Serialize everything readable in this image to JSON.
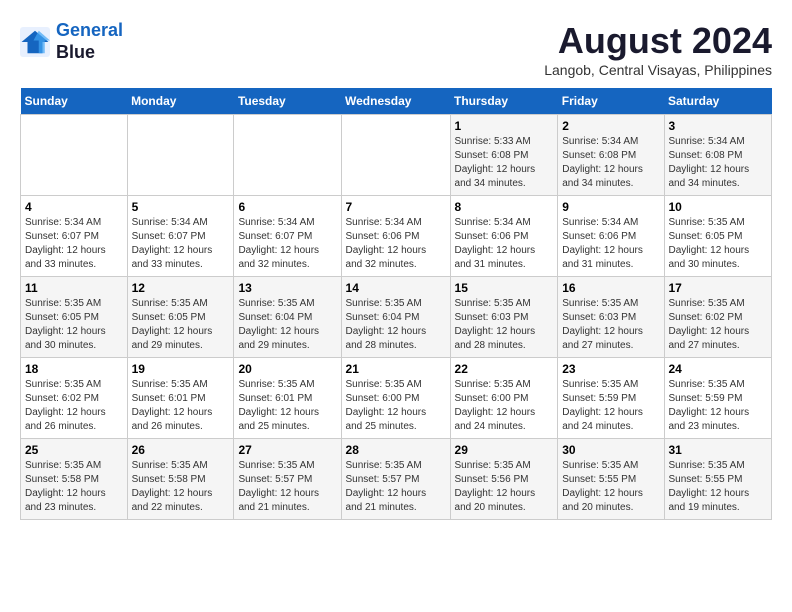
{
  "logo": {
    "line1": "General",
    "line2": "Blue"
  },
  "title": "August 2024",
  "subtitle": "Langob, Central Visayas, Philippines",
  "days_of_week": [
    "Sunday",
    "Monday",
    "Tuesday",
    "Wednesday",
    "Thursday",
    "Friday",
    "Saturday"
  ],
  "weeks": [
    [
      {
        "day": "",
        "info": ""
      },
      {
        "day": "",
        "info": ""
      },
      {
        "day": "",
        "info": ""
      },
      {
        "day": "",
        "info": ""
      },
      {
        "day": "1",
        "info": "Sunrise: 5:33 AM\nSunset: 6:08 PM\nDaylight: 12 hours\nand 34 minutes."
      },
      {
        "day": "2",
        "info": "Sunrise: 5:34 AM\nSunset: 6:08 PM\nDaylight: 12 hours\nand 34 minutes."
      },
      {
        "day": "3",
        "info": "Sunrise: 5:34 AM\nSunset: 6:08 PM\nDaylight: 12 hours\nand 34 minutes."
      }
    ],
    [
      {
        "day": "4",
        "info": "Sunrise: 5:34 AM\nSunset: 6:07 PM\nDaylight: 12 hours\nand 33 minutes."
      },
      {
        "day": "5",
        "info": "Sunrise: 5:34 AM\nSunset: 6:07 PM\nDaylight: 12 hours\nand 33 minutes."
      },
      {
        "day": "6",
        "info": "Sunrise: 5:34 AM\nSunset: 6:07 PM\nDaylight: 12 hours\nand 32 minutes."
      },
      {
        "day": "7",
        "info": "Sunrise: 5:34 AM\nSunset: 6:06 PM\nDaylight: 12 hours\nand 32 minutes."
      },
      {
        "day": "8",
        "info": "Sunrise: 5:34 AM\nSunset: 6:06 PM\nDaylight: 12 hours\nand 31 minutes."
      },
      {
        "day": "9",
        "info": "Sunrise: 5:34 AM\nSunset: 6:06 PM\nDaylight: 12 hours\nand 31 minutes."
      },
      {
        "day": "10",
        "info": "Sunrise: 5:35 AM\nSunset: 6:05 PM\nDaylight: 12 hours\nand 30 minutes."
      }
    ],
    [
      {
        "day": "11",
        "info": "Sunrise: 5:35 AM\nSunset: 6:05 PM\nDaylight: 12 hours\nand 30 minutes."
      },
      {
        "day": "12",
        "info": "Sunrise: 5:35 AM\nSunset: 6:05 PM\nDaylight: 12 hours\nand 29 minutes."
      },
      {
        "day": "13",
        "info": "Sunrise: 5:35 AM\nSunset: 6:04 PM\nDaylight: 12 hours\nand 29 minutes."
      },
      {
        "day": "14",
        "info": "Sunrise: 5:35 AM\nSunset: 6:04 PM\nDaylight: 12 hours\nand 28 minutes."
      },
      {
        "day": "15",
        "info": "Sunrise: 5:35 AM\nSunset: 6:03 PM\nDaylight: 12 hours\nand 28 minutes."
      },
      {
        "day": "16",
        "info": "Sunrise: 5:35 AM\nSunset: 6:03 PM\nDaylight: 12 hours\nand 27 minutes."
      },
      {
        "day": "17",
        "info": "Sunrise: 5:35 AM\nSunset: 6:02 PM\nDaylight: 12 hours\nand 27 minutes."
      }
    ],
    [
      {
        "day": "18",
        "info": "Sunrise: 5:35 AM\nSunset: 6:02 PM\nDaylight: 12 hours\nand 26 minutes."
      },
      {
        "day": "19",
        "info": "Sunrise: 5:35 AM\nSunset: 6:01 PM\nDaylight: 12 hours\nand 26 minutes."
      },
      {
        "day": "20",
        "info": "Sunrise: 5:35 AM\nSunset: 6:01 PM\nDaylight: 12 hours\nand 25 minutes."
      },
      {
        "day": "21",
        "info": "Sunrise: 5:35 AM\nSunset: 6:00 PM\nDaylight: 12 hours\nand 25 minutes."
      },
      {
        "day": "22",
        "info": "Sunrise: 5:35 AM\nSunset: 6:00 PM\nDaylight: 12 hours\nand 24 minutes."
      },
      {
        "day": "23",
        "info": "Sunrise: 5:35 AM\nSunset: 5:59 PM\nDaylight: 12 hours\nand 24 minutes."
      },
      {
        "day": "24",
        "info": "Sunrise: 5:35 AM\nSunset: 5:59 PM\nDaylight: 12 hours\nand 23 minutes."
      }
    ],
    [
      {
        "day": "25",
        "info": "Sunrise: 5:35 AM\nSunset: 5:58 PM\nDaylight: 12 hours\nand 23 minutes."
      },
      {
        "day": "26",
        "info": "Sunrise: 5:35 AM\nSunset: 5:58 PM\nDaylight: 12 hours\nand 22 minutes."
      },
      {
        "day": "27",
        "info": "Sunrise: 5:35 AM\nSunset: 5:57 PM\nDaylight: 12 hours\nand 21 minutes."
      },
      {
        "day": "28",
        "info": "Sunrise: 5:35 AM\nSunset: 5:57 PM\nDaylight: 12 hours\nand 21 minutes."
      },
      {
        "day": "29",
        "info": "Sunrise: 5:35 AM\nSunset: 5:56 PM\nDaylight: 12 hours\nand 20 minutes."
      },
      {
        "day": "30",
        "info": "Sunrise: 5:35 AM\nSunset: 5:55 PM\nDaylight: 12 hours\nand 20 minutes."
      },
      {
        "day": "31",
        "info": "Sunrise: 5:35 AM\nSunset: 5:55 PM\nDaylight: 12 hours\nand 19 minutes."
      }
    ]
  ]
}
